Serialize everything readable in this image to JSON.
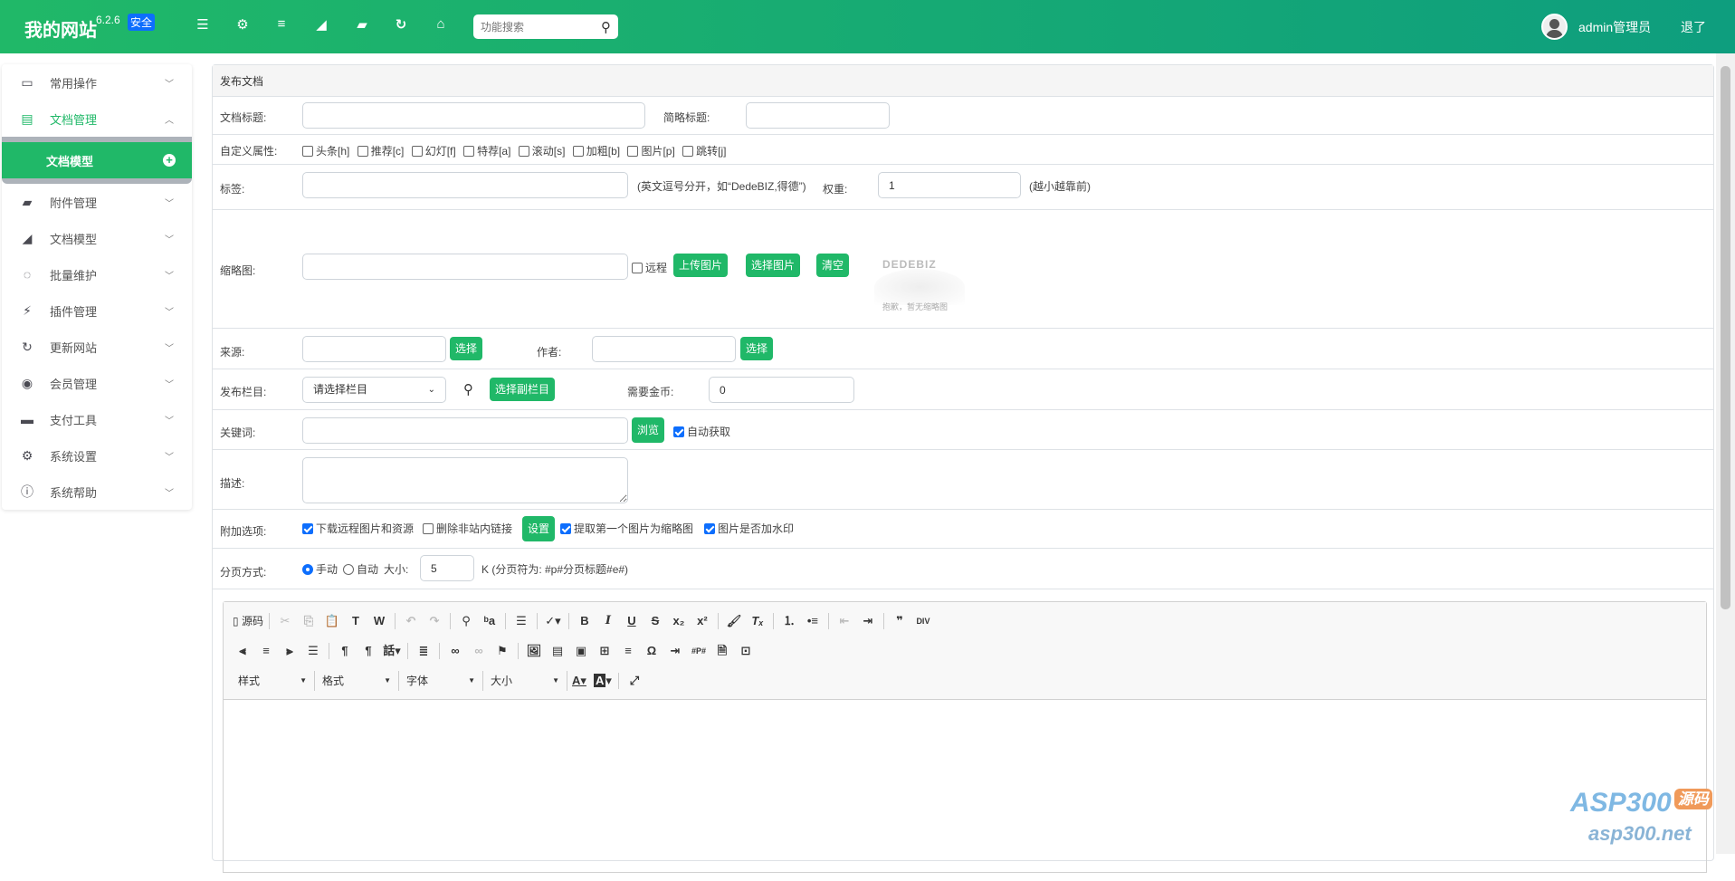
{
  "header": {
    "site_name": "我的网站",
    "version": "6.2.6",
    "badge": "安全",
    "search_placeholder": "功能搜索",
    "user": "admin管理员",
    "logout": "退了",
    "icons": [
      "outdent-icon",
      "gear-icon",
      "list-icon",
      "area-chart-icon",
      "folder-icon",
      "refresh-icon",
      "home-icon"
    ]
  },
  "sidebar": {
    "items": [
      {
        "label": "常用操作",
        "icon": "desktop-icon"
      },
      {
        "label": "文档管理",
        "icon": "file-icon",
        "open": true,
        "sub": [
          {
            "label": "文档模型"
          }
        ]
      },
      {
        "label": "附件管理",
        "icon": "folder-icon"
      },
      {
        "label": "文档模型",
        "icon": "area-chart-icon"
      },
      {
        "label": "批量维护",
        "icon": "circle-notch-icon"
      },
      {
        "label": "插件管理",
        "icon": "plug-icon"
      },
      {
        "label": "更新网站",
        "icon": "refresh-icon"
      },
      {
        "label": "会员管理",
        "icon": "user-circle-icon"
      },
      {
        "label": "支付工具",
        "icon": "credit-card-icon"
      },
      {
        "label": "系统设置",
        "icon": "gear-icon"
      },
      {
        "label": "系统帮助",
        "icon": "info-icon"
      }
    ]
  },
  "form": {
    "title": "发布文档",
    "doc_title_label": "文档标题:",
    "short_title_label": "简略标题:",
    "attr_label": "自定义属性:",
    "attrs": [
      "头条[h]",
      "推荐[c]",
      "幻灯[f]",
      "特荐[a]",
      "滚动[s]",
      "加粗[b]",
      "图片[p]",
      "跳转[j]"
    ],
    "tags_label": "标签:",
    "tags_hint": "(英文逗号分开，如“DedeBIZ,得德”)",
    "weight_label": "权重:",
    "weight_value": "1",
    "weight_hint": "(越小越靠前)",
    "thumb_label": "缩略图:",
    "remote_label": "远程",
    "upload_btn": "上传图片",
    "choose_btn": "选择图片",
    "clear_btn": "清空",
    "thumb_brand": "DEDEBIZ",
    "thumb_caption": "抱歉，暂无缩略图",
    "source_label": "来源:",
    "source_btn": "选择",
    "author_label": "作者:",
    "author_btn": "选择",
    "column_label": "发布栏目:",
    "column_select": "请选择栏目",
    "subcolumn_btn": "选择副栏目",
    "coins_label": "需要金币:",
    "coins_value": "0",
    "keywords_label": "关键词:",
    "browse_btn": "浏览",
    "auto_fetch": "自动获取",
    "desc_label": "描述:",
    "extra_label": "附加选项:",
    "extra_download": "下载远程图片和资源",
    "extra_remove_links": "删除非站内链接",
    "extra_settings_btn": "设置",
    "extra_first_thumb": "提取第一个图片为缩略图",
    "extra_watermark": "图片是否加水印",
    "paging_label": "分页方式:",
    "paging_manual": "手动",
    "paging_auto": "自动",
    "paging_size_label": "大小:",
    "paging_size": "5",
    "paging_hint": "K (分页符为: #p#分页标题#e#)"
  },
  "editor": {
    "source": "源码",
    "combos": [
      "样式",
      "格式",
      "字体",
      "大小"
    ]
  },
  "watermark": {
    "brand": "ASP300",
    "tag": "源码",
    "url": "asp300.net"
  }
}
